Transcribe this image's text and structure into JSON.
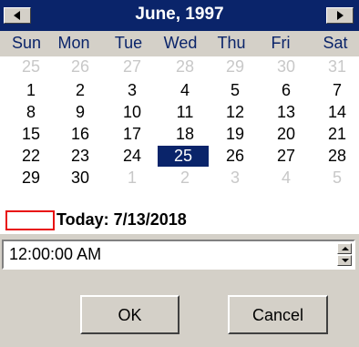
{
  "calendar": {
    "title": "June, 1997",
    "nav": {
      "prev_icon": "left-arrow",
      "next_icon": "right-arrow"
    },
    "weekdays": [
      "Sun",
      "Mon",
      "Tue",
      "Wed",
      "Thu",
      "Fri",
      "Sat"
    ],
    "weeks": [
      [
        {
          "d": "25",
          "o": true
        },
        {
          "d": "26",
          "o": true
        },
        {
          "d": "27",
          "o": true
        },
        {
          "d": "28",
          "o": true
        },
        {
          "d": "29",
          "o": true
        },
        {
          "d": "30",
          "o": true
        },
        {
          "d": "31",
          "o": true
        }
      ],
      [
        {
          "d": "1"
        },
        {
          "d": "2"
        },
        {
          "d": "3"
        },
        {
          "d": "4"
        },
        {
          "d": "5"
        },
        {
          "d": "6"
        },
        {
          "d": "7"
        }
      ],
      [
        {
          "d": "8"
        },
        {
          "d": "9"
        },
        {
          "d": "10"
        },
        {
          "d": "11"
        },
        {
          "d": "12"
        },
        {
          "d": "13"
        },
        {
          "d": "14"
        }
      ],
      [
        {
          "d": "15"
        },
        {
          "d": "16"
        },
        {
          "d": "17"
        },
        {
          "d": "18"
        },
        {
          "d": "19"
        },
        {
          "d": "20"
        },
        {
          "d": "21"
        }
      ],
      [
        {
          "d": "22"
        },
        {
          "d": "23"
        },
        {
          "d": "24"
        },
        {
          "d": "25",
          "s": true
        },
        {
          "d": "26"
        },
        {
          "d": "27"
        },
        {
          "d": "28"
        }
      ],
      [
        {
          "d": "29"
        },
        {
          "d": "30"
        },
        {
          "d": "1",
          "o": true
        },
        {
          "d": "2",
          "o": true
        },
        {
          "d": "3",
          "o": true
        },
        {
          "d": "4",
          "o": true
        },
        {
          "d": "5",
          "o": true
        }
      ]
    ],
    "today_label": "Today: 7/13/2018"
  },
  "time": {
    "value": "12:00:00 AM"
  },
  "buttons": {
    "ok": "OK",
    "cancel": "Cancel"
  },
  "colors": {
    "header": "#0a246a",
    "selected": "#0a246a",
    "today_box": "#e81010",
    "face": "#d4d0c8"
  }
}
